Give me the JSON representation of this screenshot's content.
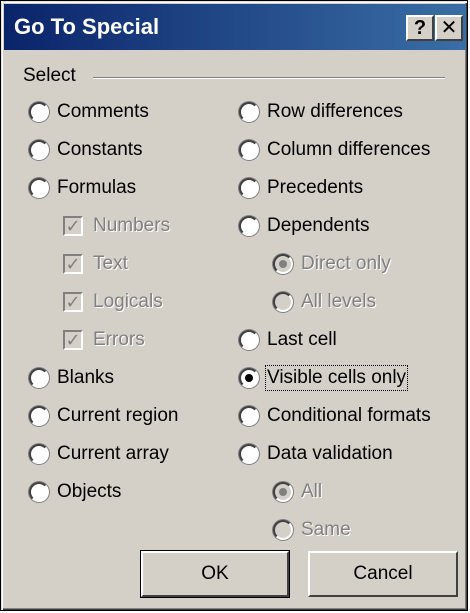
{
  "window": {
    "title": "Go To Special",
    "help_label": "?",
    "close_label": "✕"
  },
  "group": {
    "label": "Select"
  },
  "options": {
    "comments": "Comments",
    "constants": "Constants",
    "formulas": "Formulas",
    "numbers": "Numbers",
    "text": "Text",
    "logicals": "Logicals",
    "errors": "Errors",
    "blanks": "Blanks",
    "current_region": "Current region",
    "current_array": "Current array",
    "objects": "Objects",
    "row_differences": "Row differences",
    "column_differences": "Column differences",
    "precedents": "Precedents",
    "dependents": "Dependents",
    "direct_only": "Direct only",
    "all_levels": "All levels",
    "last_cell": "Last cell",
    "visible_cells_only": "Visible cells only",
    "conditional_formats": "Conditional formats",
    "data_validation": "Data validation",
    "all": "All",
    "same": "Same"
  },
  "selected_option": "Visible cells only",
  "buttons": {
    "ok": "OK",
    "cancel": "Cancel"
  }
}
